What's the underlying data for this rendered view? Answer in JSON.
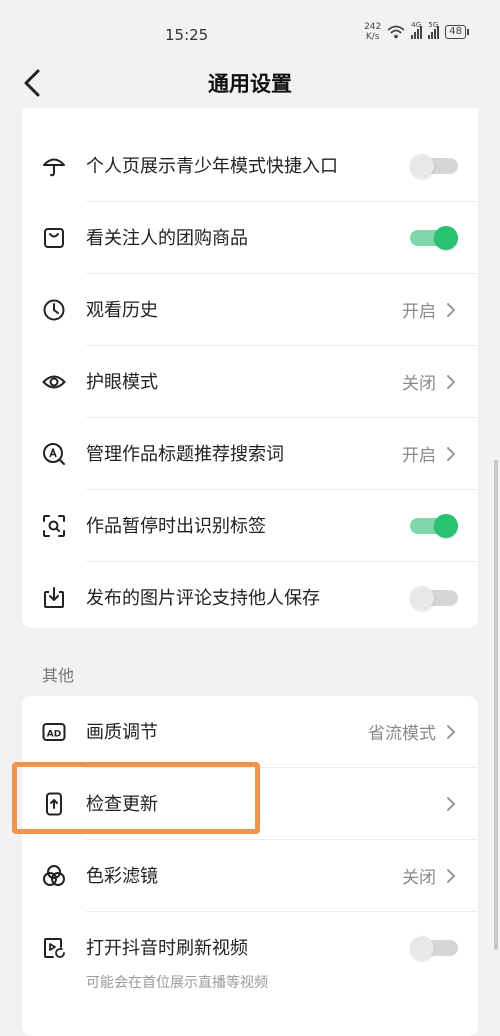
{
  "status_bar": {
    "time": "15:25",
    "net_speed": "242",
    "net_unit": "K/s",
    "sig1_tag": "4G",
    "sig2_tag": "5G",
    "battery": "48"
  },
  "header": {
    "title": "通用设置"
  },
  "settings": [
    {
      "label": "个人页展示青少年模式快捷入口",
      "icon": "umbrella-icon",
      "toggle": false
    },
    {
      "label": "看关注人的团购商品",
      "icon": "shopping-bag-icon",
      "toggle": true
    },
    {
      "label": "观看历史",
      "icon": "clock-icon",
      "value": "开启"
    },
    {
      "label": "护眼模式",
      "icon": "eye-icon",
      "value": "关闭"
    },
    {
      "label": "管理作品标题推荐搜索词",
      "icon": "search-a-icon",
      "value": "开启"
    },
    {
      "label": "作品暂停时出识别标签",
      "icon": "scan-icon",
      "toggle": true
    },
    {
      "label": "发布的图片评论支持他人保存",
      "icon": "download-icon",
      "toggle": false
    }
  ],
  "other": {
    "header": "其他",
    "items": [
      {
        "label": "画质调节",
        "icon": "ad-icon",
        "value": "省流模式"
      },
      {
        "label": "检查更新",
        "icon": "phone-update-icon",
        "value": ""
      },
      {
        "label": "色彩滤镜",
        "icon": "color-filter-icon",
        "value": "关闭"
      },
      {
        "label": "打开抖音时刷新视频",
        "icon": "video-refresh-icon",
        "toggle": false,
        "sub": "可能会在首位展示直播等视频"
      }
    ]
  },
  "colors": {
    "toggle_on": "#28c272",
    "highlight": "#f0954e"
  }
}
